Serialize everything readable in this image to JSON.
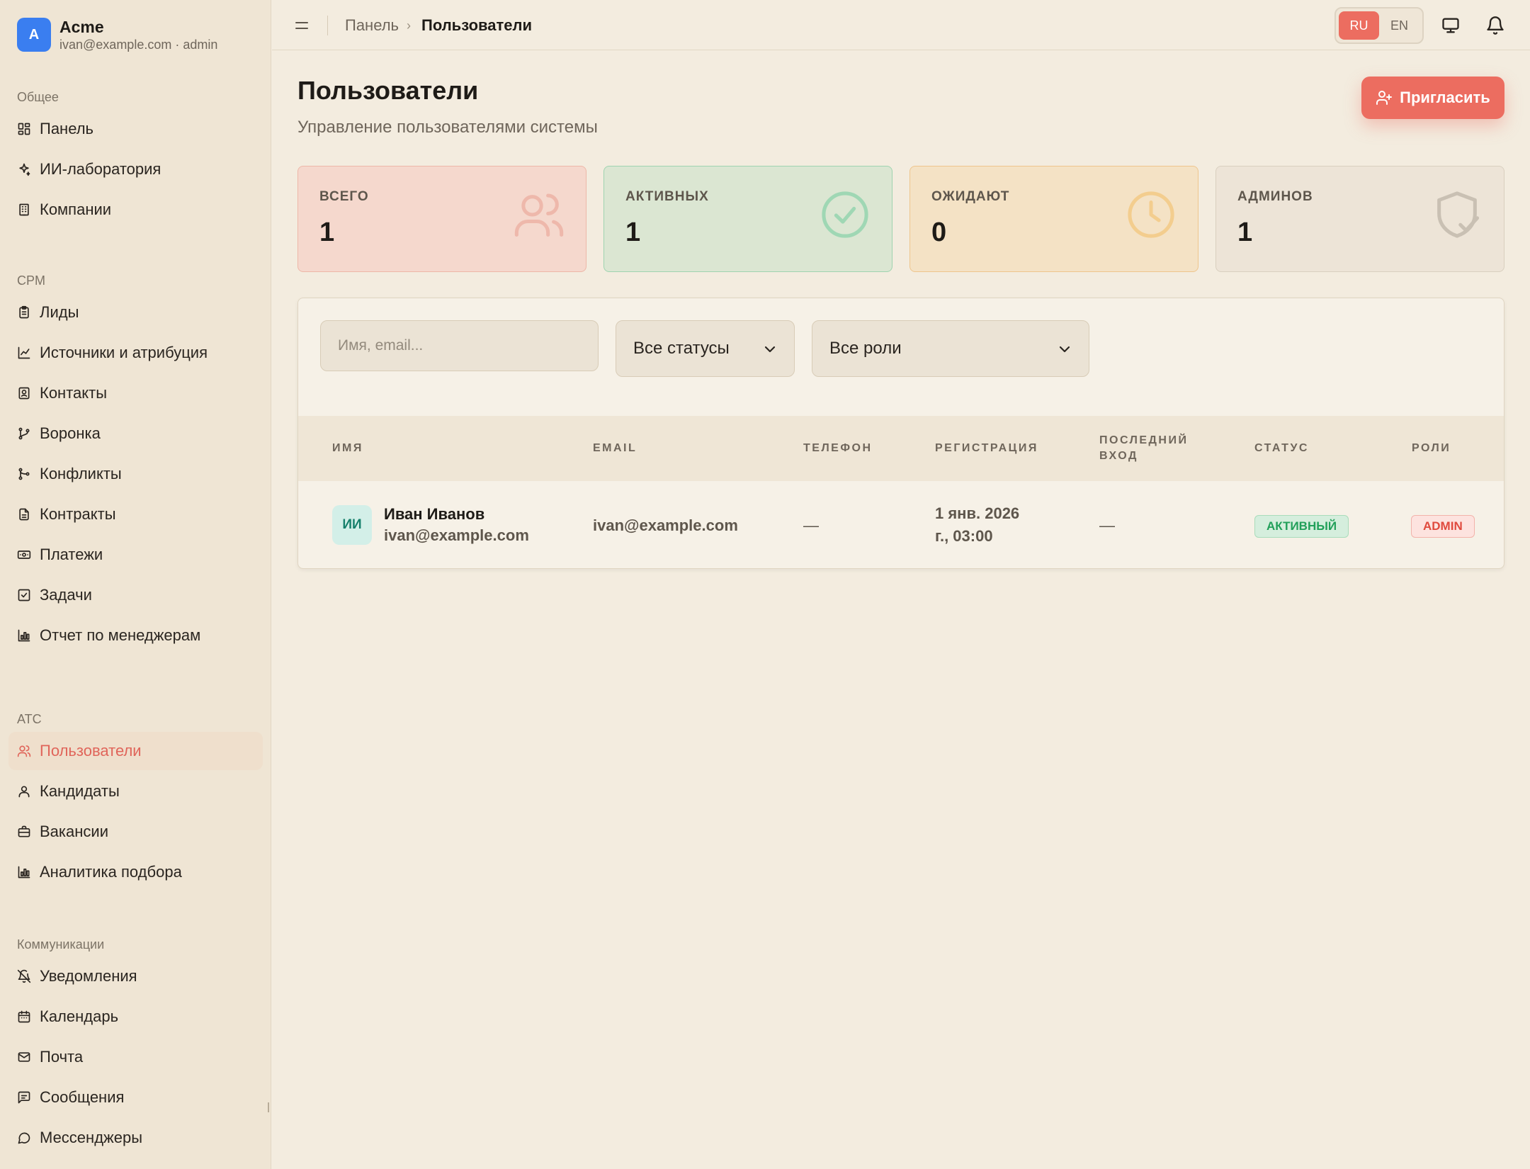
{
  "brand": {
    "initial": "A",
    "name": "Acme",
    "subtitle": "ivan@example.com · admin"
  },
  "sidebar": {
    "sections": [
      {
        "heading": "Общее",
        "items": [
          {
            "label": "Панель",
            "icon": "dashboard-icon"
          },
          {
            "label": "ИИ-лаборатория",
            "icon": "sparkles-icon"
          },
          {
            "label": "Компании",
            "icon": "building-icon"
          }
        ]
      },
      {
        "heading": "CPM",
        "items": [
          {
            "label": "Лиды",
            "icon": "clipboard-icon"
          },
          {
            "label": "Источники и атрибуция",
            "icon": "chart-line-icon"
          },
          {
            "label": "Контакты",
            "icon": "contact-icon"
          },
          {
            "label": "Воронка",
            "icon": "git-branch-icon"
          },
          {
            "label": "Конфликты",
            "icon": "git-merge-icon"
          },
          {
            "label": "Контракты",
            "icon": "file-icon"
          },
          {
            "label": "Платежи",
            "icon": "banknote-icon"
          },
          {
            "label": "Задачи",
            "icon": "checkbox-icon"
          },
          {
            "label": "Отчет по менеджерам",
            "icon": "bar-chart-icon"
          }
        ]
      },
      {
        "heading": "ATC",
        "items": [
          {
            "label": "Пользователи",
            "icon": "users-icon",
            "active": true
          },
          {
            "label": "Кандидаты",
            "icon": "user-icon"
          },
          {
            "label": "Вакансии",
            "icon": "briefcase-icon"
          },
          {
            "label": "Аналитика подбора",
            "icon": "bar-chart-icon"
          }
        ]
      },
      {
        "heading": "Коммуникации",
        "items": [
          {
            "label": "Уведомления",
            "icon": "bell-off-icon"
          },
          {
            "label": "Календарь",
            "icon": "calendar-icon"
          },
          {
            "label": "Почта",
            "icon": "mail-icon"
          },
          {
            "label": "Сообщения",
            "icon": "message-square-icon"
          },
          {
            "label": "Мессенджеры",
            "icon": "message-circle-icon"
          }
        ]
      }
    ]
  },
  "header": {
    "breadcrumb": [
      "Панель",
      "Пользователи"
    ],
    "lang": {
      "ru": "RU",
      "en": "EN",
      "active": "RU"
    }
  },
  "page": {
    "title": "Пользователи",
    "subtitle": "Управление пользователями системы",
    "invite_label": "Пригласить"
  },
  "stats": [
    {
      "label": "ВСЕГО",
      "value": "1",
      "icon": "users-icon",
      "bg": "#f5d8cd",
      "border": "#edb7a8",
      "iconColor": "#eeb8ab"
    },
    {
      "label": "АКТИВНЫХ",
      "value": "1",
      "icon": "check-circle-icon",
      "bg": "#dbe6d2",
      "border": "#9fd4b0",
      "iconColor": "#9fd7b4"
    },
    {
      "label": "ОЖИДАЮТ",
      "value": "0",
      "icon": "clock-icon",
      "bg": "#f4e2c5",
      "border": "#eec58d",
      "iconColor": "#f3cd8e"
    },
    {
      "label": "АДМИНОВ",
      "value": "1",
      "icon": "shield-check-icon",
      "bg": "#ede4d7",
      "border": "#d9cfbf",
      "iconColor": "#c9c0b3"
    }
  ],
  "filters": {
    "search_placeholder": "Имя, email...",
    "status_value": "Все статусы",
    "role_value": "Все роли"
  },
  "table": {
    "columns": [
      "ИМЯ",
      "EMAIL",
      "ТЕЛЕФОН",
      "РЕГИСТРАЦИЯ",
      "ПОСЛЕДНИЙ ВХОД",
      "СТАТУС",
      "РОЛИ"
    ],
    "rows": [
      {
        "initials": "ИИ",
        "name": "Иван Иванов",
        "name_email": "ivan@example.com",
        "email": "ivan@example.com",
        "phone": "—",
        "registered_line1": "1 янв. 2026",
        "registered_line2": "г., 03:00",
        "last_login": "—",
        "status": "АКТИВНЫЙ",
        "role": "ADMIN"
      }
    ]
  }
}
